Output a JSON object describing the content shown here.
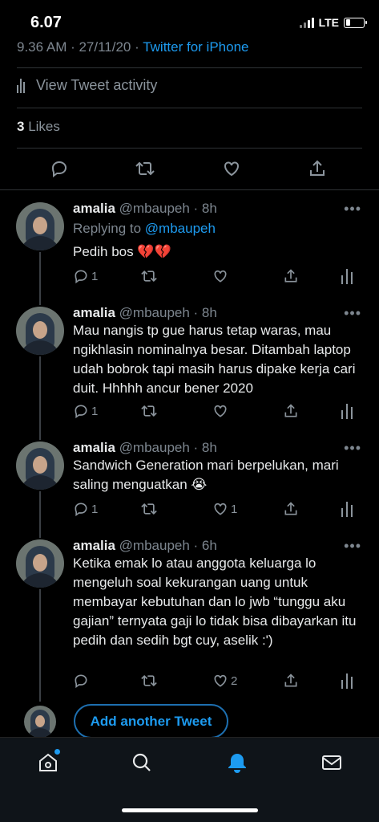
{
  "status_bar": {
    "time": "6.07",
    "network": "LTE"
  },
  "tweet_meta": {
    "timestamp": "9.36 AM · 27/11/20 · ",
    "client": "Twitter for iPhone"
  },
  "activity": {
    "label": "View Tweet activity"
  },
  "likes": {
    "count": "3",
    "label": " Likes"
  },
  "replies": [
    {
      "name": "amalia",
      "handle": "@mbaupeh · 8h",
      "replying_prefix": "Replying to ",
      "replying_to": "@mbaupeh",
      "text": "Pedih bos 💔💔",
      "reply_count": "1",
      "retweet_count": "",
      "like_count": ""
    },
    {
      "name": "amalia",
      "handle": "@mbaupeh · 8h",
      "text": "Mau nangis tp gue harus tetap waras, mau ngikhlasin nominalnya besar. Ditambah laptop udah bobrok tapi masih harus dipake kerja cari duit. Hhhhh ancur bener 2020",
      "reply_count": "1",
      "retweet_count": "",
      "like_count": ""
    },
    {
      "name": "amalia",
      "handle": "@mbaupeh · 8h",
      "text": "Sandwich Generation mari berpelukan, mari saling menguatkan 😭",
      "reply_count": "1",
      "retweet_count": "",
      "like_count": "1"
    },
    {
      "name": "amalia",
      "handle": "@mbaupeh · 6h",
      "text": "Ketika emak lo atau anggota keluarga lo mengeluh soal kekurangan uang untuk membayar kebutuhan dan lo jwb “tunggu aku gajian” ternyata gaji lo tidak bisa dibayarkan itu pedih dan sedih bgt cuy, aselik :')",
      "reply_count": "",
      "retweet_count": "",
      "like_count": "2"
    }
  ],
  "compose": {
    "button_label": "Add another Tweet"
  },
  "more_label": "•••",
  "colors": {
    "accent": "#1d9bf0",
    "background": "#000000",
    "muted": "#7d868f"
  },
  "icons": [
    "reply-icon",
    "retweet-icon",
    "like-icon",
    "share-icon",
    "analytics-icon",
    "home-icon",
    "search-icon",
    "notifications-icon",
    "messages-icon"
  ]
}
